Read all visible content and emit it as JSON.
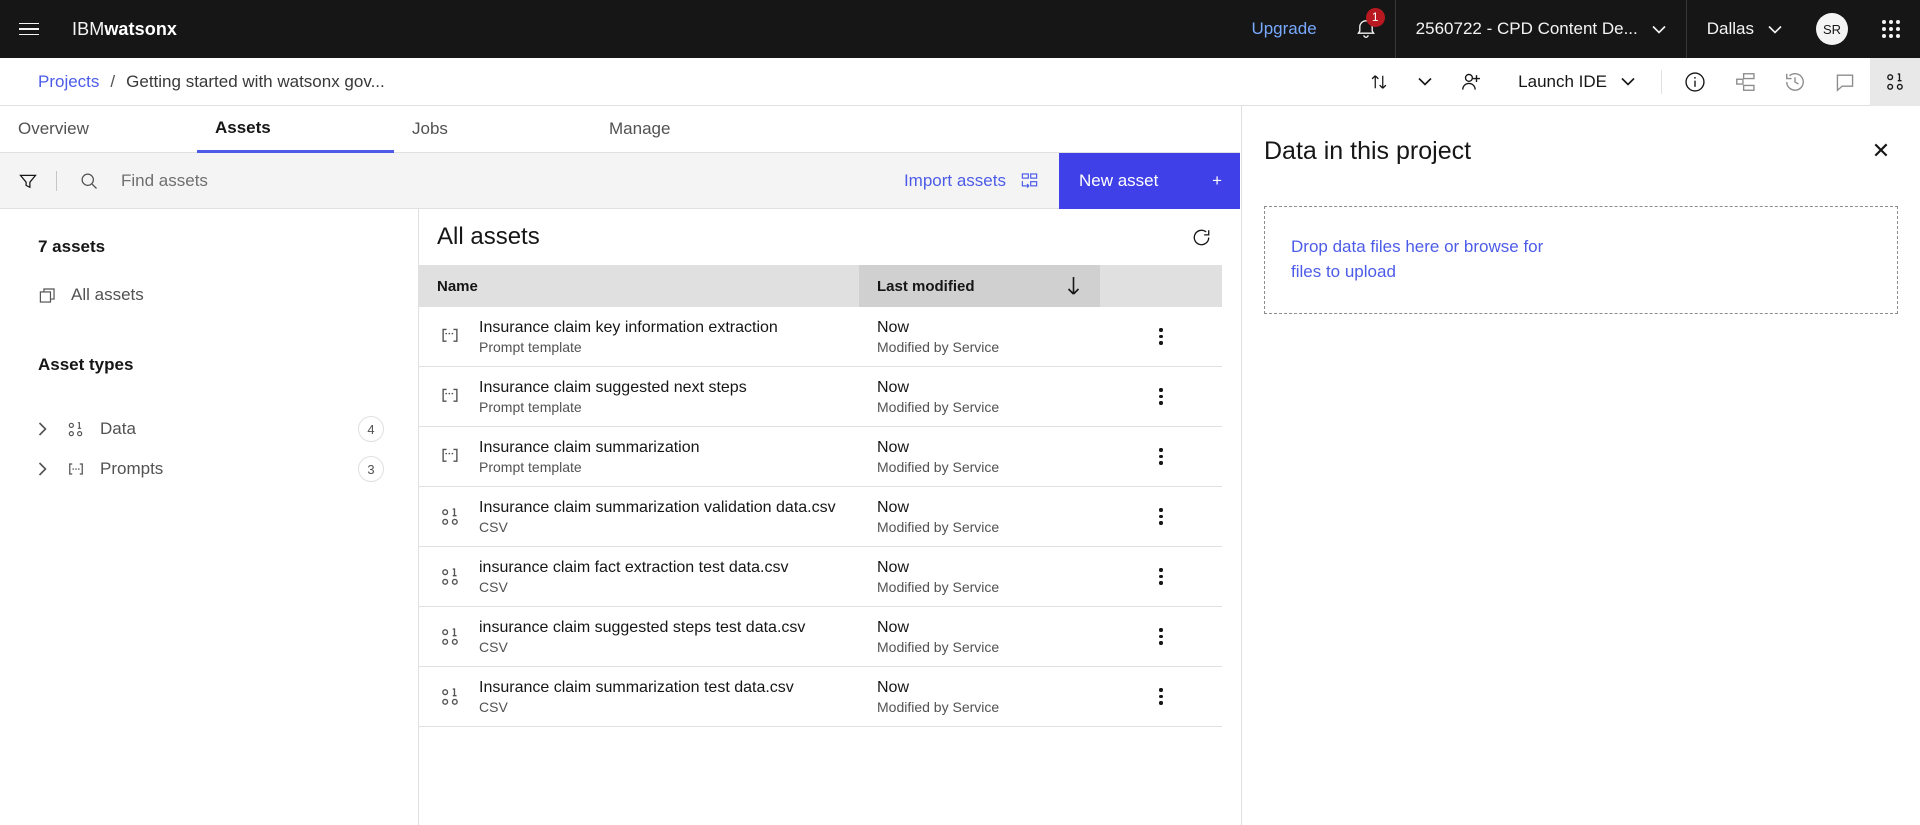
{
  "header": {
    "menu_icon": "hamburger-menu-icon",
    "brand_light": "IBM",
    "brand_bold": "watsonx",
    "upgrade_label": "Upgrade",
    "notification_icon": "bell-icon",
    "notification_count": "1",
    "account_label": "2560722 - CPD Content De...",
    "account_chevron": "chevron-down-icon",
    "region_label": "Dallas",
    "region_chevron": "chevron-down-icon",
    "avatar_initials": "SR",
    "app_switcher_icon": "app-switcher-icon"
  },
  "breadcrumb": {
    "projects_label": "Projects",
    "separator": "/",
    "current_label": "Getting started with watsonx gov...",
    "actions": {
      "transfer_icon": "arrows-up-down-icon",
      "transfer_chevron_icon": "chevron-down-icon",
      "add_collaborator_icon": "user-add-icon",
      "launch_ide_label": "Launch IDE",
      "launch_ide_chevron": "chevron-down-icon",
      "info_icon": "information-icon",
      "workflow_icon": "flow-icon",
      "history_icon": "history-clock-icon",
      "comment_icon": "comment-icon",
      "data_panel_icon": "data-icon"
    }
  },
  "tabs": [
    {
      "label": "Overview",
      "active": false
    },
    {
      "label": "Assets",
      "active": true
    },
    {
      "label": "Jobs",
      "active": false
    },
    {
      "label": "Manage",
      "active": false
    }
  ],
  "actionbar": {
    "filter_icon": "filter-icon",
    "search_icon": "search-icon",
    "search_placeholder": "Find assets",
    "search_value": "",
    "import_label": "Import assets",
    "import_icon": "import-assets-icon",
    "new_asset_label": "New asset",
    "new_asset_plus": "+",
    "accent_color": "#4040e8"
  },
  "left_panel": {
    "assets_count_label": "7 assets",
    "all_assets_icon": "copy-stack-icon",
    "all_assets_label": "All assets",
    "asset_types_heading": "Asset types",
    "types": [
      {
        "chevron": "chevron-right-icon",
        "icon": "data-icon",
        "label": "Data",
        "count": "4"
      },
      {
        "chevron": "chevron-right-icon",
        "icon": "prompt-icon",
        "label": "Prompts",
        "count": "3"
      }
    ]
  },
  "table": {
    "title": "All assets",
    "refresh_icon": "refresh-icon",
    "columns": {
      "name": "Name",
      "last_modified": "Last modified",
      "sort_icon": "arrow-down-icon"
    },
    "overflow_icon": "overflow-menu-icon",
    "rows": [
      {
        "icon": "prompt-template-icon",
        "name": "Insurance claim key information extraction",
        "type": "Prompt template",
        "modified": "Now",
        "modified_by": "Modified by Service"
      },
      {
        "icon": "prompt-template-icon",
        "name": "Insurance claim suggested next steps",
        "type": "Prompt template",
        "modified": "Now",
        "modified_by": "Modified by Service"
      },
      {
        "icon": "prompt-template-icon",
        "name": "Insurance claim summarization",
        "type": "Prompt template",
        "modified": "Now",
        "modified_by": "Modified by Service"
      },
      {
        "icon": "data-icon",
        "name": "Insurance claim summarization validation data.csv",
        "type": "CSV",
        "modified": "Now",
        "modified_by": "Modified by Service"
      },
      {
        "icon": "data-icon",
        "name": "insurance claim fact extraction test data.csv",
        "type": "CSV",
        "modified": "Now",
        "modified_by": "Modified by Service"
      },
      {
        "icon": "data-icon",
        "name": "insurance claim suggested steps test data.csv",
        "type": "CSV",
        "modified": "Now",
        "modified_by": "Modified by Service"
      },
      {
        "icon": "data-icon",
        "name": "Insurance claim summarization test data.csv",
        "type": "CSV",
        "modified": "Now",
        "modified_by": "Modified by Service"
      }
    ]
  },
  "right_panel": {
    "title": "Data in this project",
    "close_icon": "close-icon",
    "dropzone_text": "Drop data files here or browse for files to upload"
  }
}
